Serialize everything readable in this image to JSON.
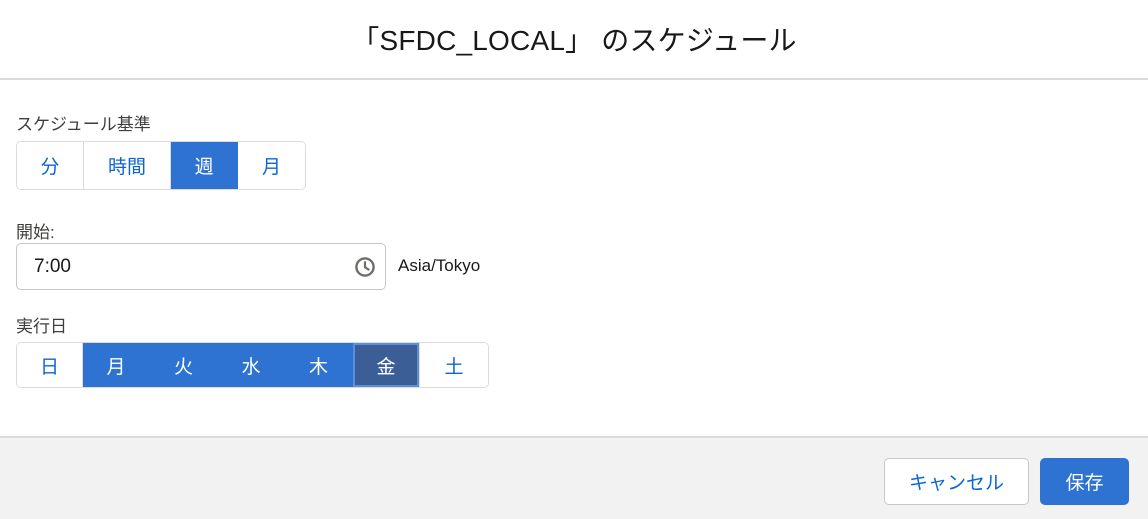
{
  "header": {
    "title": "「SFDC_LOCAL」 のスケジュール"
  },
  "schedule_basis": {
    "label": "スケジュール基準",
    "options": [
      "分",
      "時間",
      "週",
      "月"
    ],
    "selected": "週"
  },
  "start": {
    "label": "開始:",
    "value": "7:00",
    "timezone": "Asia/Tokyo",
    "icon": "clock-icon"
  },
  "run_days": {
    "label": "実行日",
    "days": [
      "日",
      "月",
      "火",
      "水",
      "木",
      "金",
      "土"
    ],
    "selected": [
      "月",
      "火",
      "水",
      "木",
      "金"
    ],
    "focused": "金"
  },
  "footer": {
    "cancel_label": "キャンセル",
    "save_label": "保存"
  },
  "colors": {
    "brand": "#2e72d2",
    "link": "#0b66d0",
    "focused": "#3b5e96",
    "footer_bg": "#f3f2f2"
  }
}
